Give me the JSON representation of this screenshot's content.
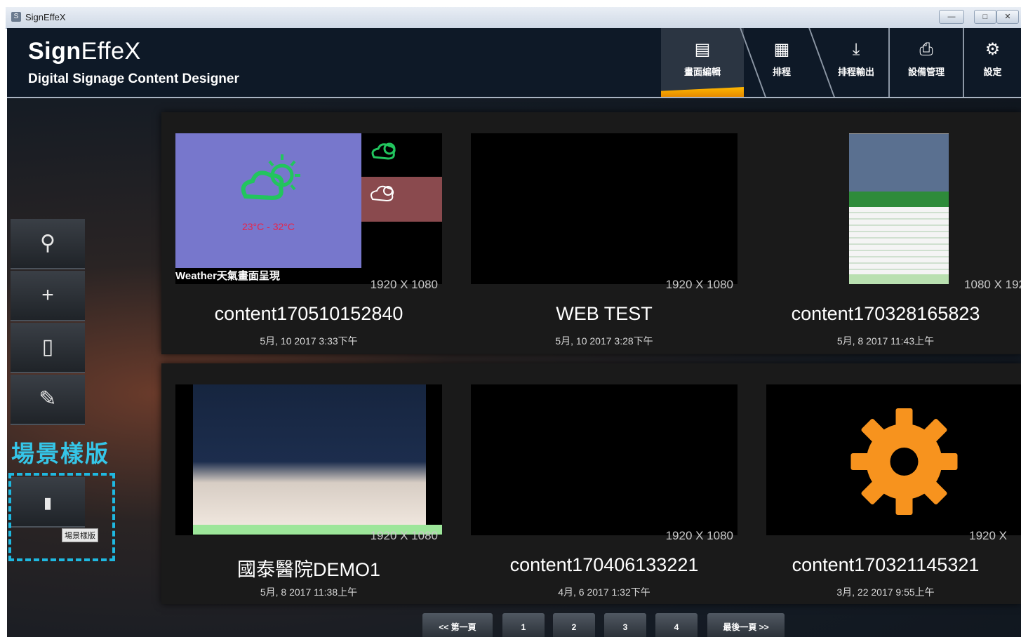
{
  "window": {
    "title": "SignEffeX"
  },
  "brand": {
    "name_part1": "Sign",
    "name_part2": "EffeX",
    "subtitle": "Digital Signage Content Designer"
  },
  "nav": [
    {
      "label": "畫面編輯",
      "icon": "image-edit-icon",
      "active": true
    },
    {
      "label": "排程",
      "icon": "calendar-icon"
    },
    {
      "label": "排程輸出",
      "icon": "download-icon"
    },
    {
      "label": "設備管理",
      "icon": "device-icon"
    },
    {
      "label": "設定",
      "icon": "gear-icon"
    }
  ],
  "sidebar": {
    "buttons": [
      {
        "name": "search",
        "icon": "search-icon"
      },
      {
        "name": "add",
        "icon": "plus-icon"
      },
      {
        "name": "delete",
        "icon": "trash-icon"
      },
      {
        "name": "edit",
        "icon": "edit-icon"
      },
      {
        "name": "template",
        "icon": "document-icon"
      }
    ],
    "template_label": "場景樣版",
    "tooltip": "場景樣版"
  },
  "contents": [
    {
      "name": "content170510152840",
      "resolution": "1920 X 1080",
      "date": "5月, 10 2017 3:33下午",
      "thumb": "weather",
      "caption": "Weather天氣畫面呈現",
      "temperature": "23°C - 32°C"
    },
    {
      "name": "WEB TEST",
      "resolution": "1920 X 1080",
      "date": "5月, 10 2017 3:28下午",
      "thumb": "black"
    },
    {
      "name": "content170328165823",
      "resolution": "1080 X 192",
      "date": "5月, 8 2017 11:43上午",
      "thumb": "poster"
    },
    {
      "name": "國泰醫院DEMO1",
      "resolution": "1920 X 1080",
      "date": "5月, 8 2017 11:38上午",
      "thumb": "video"
    },
    {
      "name": "content170406133221",
      "resolution": "1920 X 1080",
      "date": "4月, 6 2017 1:32下午",
      "thumb": "black"
    },
    {
      "name": "content170321145321",
      "resolution": "1920 X",
      "date": "3月, 22 2017 9:55上午",
      "thumb": "gear"
    }
  ],
  "pagination": {
    "first": "<< 第一頁",
    "pages": [
      "1",
      "2",
      "3",
      "4"
    ],
    "last": "最後一頁 >>",
    "current": "1"
  },
  "colors": {
    "accent": "#ffa000",
    "template_highlight": "#1fb8e0",
    "gear": "#f7931e"
  }
}
